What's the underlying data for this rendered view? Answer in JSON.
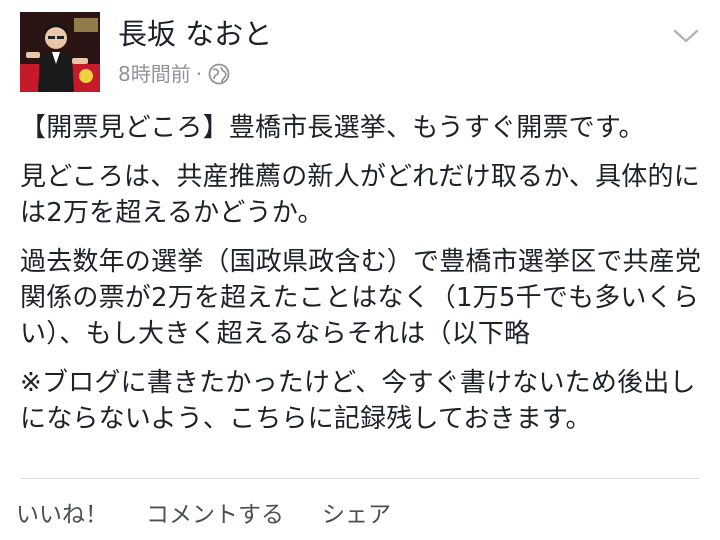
{
  "post": {
    "author_name": "長坂 なおと",
    "timestamp": "8時間前",
    "separator": "·",
    "privacy_icon": "globe-icon",
    "menu_icon": "chevron-down-icon",
    "paragraphs": [
      "【開票見どころ】豊橋市長選挙、もうすぐ開票です。",
      "見どころは、共産推薦の新人がどれだけ取るか、具体的には2万を超えるかどうか。",
      "過去数年の選挙（国政県政含む）で豊橋市選挙区で共産党関係の票が2万を超えたことはなく（1万5千でも多いくらい）、もし大きく超えるならそれは（以下略",
      "※ブログに書きたかったけど、今すぐ書けないため後出しにならないよう、こちらに記録残しておきます。"
    ]
  },
  "actions": {
    "like_label": "いいね！",
    "comment_label": "コメントする",
    "share_label": "シェア"
  },
  "colors": {
    "text": "#1d2129",
    "meta": "#90949c",
    "action": "#4b4f56",
    "divider": "#dadde1"
  }
}
